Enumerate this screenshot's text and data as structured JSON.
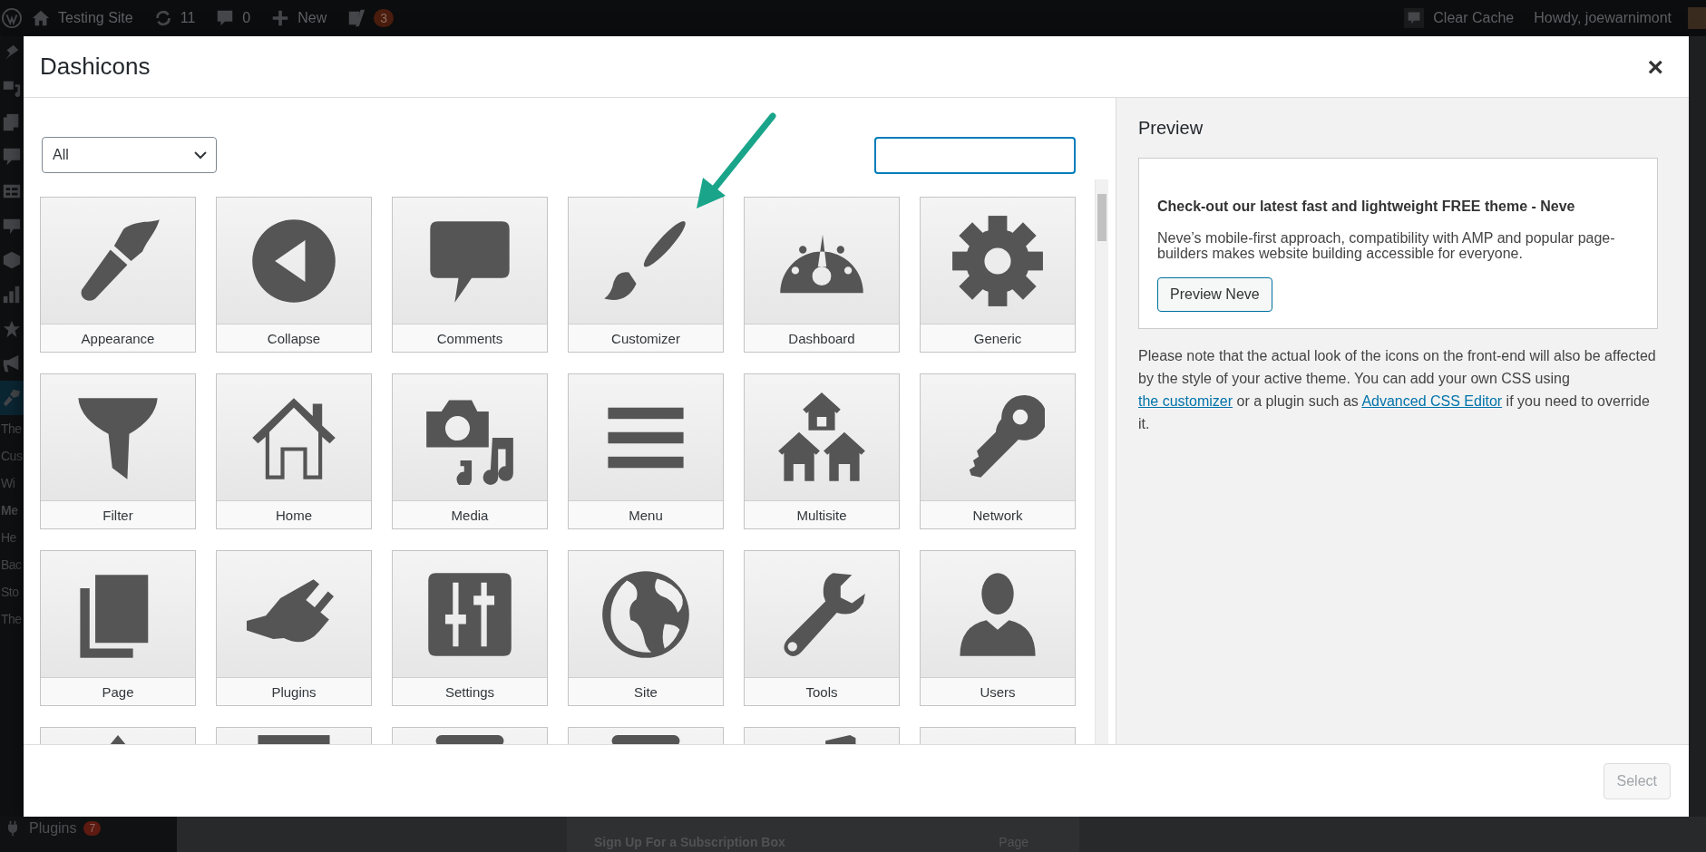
{
  "admin_bar": {
    "site_name": "Testing Site",
    "updates_count": "11",
    "comments_count": "0",
    "new_label": "New",
    "seo_badge": "3",
    "clear_cache": "Clear Cache",
    "greeting": "Howdy, joewarnimont"
  },
  "admin_sidebar": {
    "menu": [
      {
        "kind": "pin",
        "selected": false
      },
      {
        "kind": "media",
        "selected": false
      },
      {
        "kind": "pages",
        "selected": false
      },
      {
        "kind": "comment",
        "selected": false
      },
      {
        "kind": "form",
        "selected": false
      },
      {
        "kind": "bubble",
        "selected": false
      },
      {
        "kind": "cube",
        "selected": false
      },
      {
        "kind": "chart",
        "selected": false
      },
      {
        "kind": "star",
        "selected": false
      },
      {
        "kind": "megaphone",
        "selected": false
      },
      {
        "kind": "brush",
        "selected": true
      }
    ],
    "submenu": [
      {
        "label": "The",
        "current": false
      },
      {
        "label": "Cus",
        "current": false
      },
      {
        "label": "Wi",
        "current": false
      },
      {
        "label": "Me",
        "current": true
      },
      {
        "label": "He",
        "current": false
      },
      {
        "label": "Bac",
        "current": false
      },
      {
        "label": "Sto",
        "current": false
      },
      {
        "label": "The",
        "current": false
      }
    ],
    "plugins": {
      "label": "Plugins",
      "badge": "7"
    }
  },
  "background_list": {
    "title": "Sign Up For a Subscription Box",
    "type": "Page"
  },
  "dialog": {
    "title": "Dashicons",
    "close": "×",
    "filter": {
      "value": "All"
    },
    "search": {
      "focused": true
    },
    "icons": [
      {
        "kind": "appearance",
        "label": "Appearance"
      },
      {
        "kind": "collapse",
        "label": "Collapse"
      },
      {
        "kind": "comments",
        "label": "Comments"
      },
      {
        "kind": "customizer",
        "label": "Customizer"
      },
      {
        "kind": "dashboard",
        "label": "Dashboard"
      },
      {
        "kind": "generic",
        "label": "Generic"
      },
      {
        "kind": "filter",
        "label": "Filter"
      },
      {
        "kind": "home",
        "label": "Home"
      },
      {
        "kind": "media",
        "label": "Media"
      },
      {
        "kind": "menu",
        "label": "Menu"
      },
      {
        "kind": "multisite",
        "label": "Multisite"
      },
      {
        "kind": "network",
        "label": "Network"
      },
      {
        "kind": "page",
        "label": "Page"
      },
      {
        "kind": "plugins",
        "label": "Plugins"
      },
      {
        "kind": "settings",
        "label": "Settings"
      },
      {
        "kind": "site",
        "label": "Site"
      },
      {
        "kind": "tools",
        "label": "Tools"
      },
      {
        "kind": "users",
        "label": "Users"
      },
      {
        "kind": "peak"
      },
      {
        "kind": "bar"
      },
      {
        "kind": "rounded"
      },
      {
        "kind": "rounded"
      },
      {
        "kind": "wedge"
      },
      {
        "kind": "none"
      }
    ],
    "preview": {
      "heading": "Preview",
      "card_title": "Check-out our latest fast and lightweight FREE theme - Neve",
      "card_text": "Neve’s mobile-first approach, compatibility with AMP and popular page-builders makes website building accessible for everyone.",
      "card_button": "Preview Neve",
      "note_before": "Please note that the actual look of the icons on the front-end will also be affected by the style of your active theme. You can add your own CSS using",
      "note_link_1": "the customizer",
      "note_middle": "or a plugin such as",
      "note_link_2": "Advanced CSS Editor",
      "note_after": "if you need to override it."
    },
    "select_button": {
      "label": "Select",
      "disabled": true
    }
  }
}
